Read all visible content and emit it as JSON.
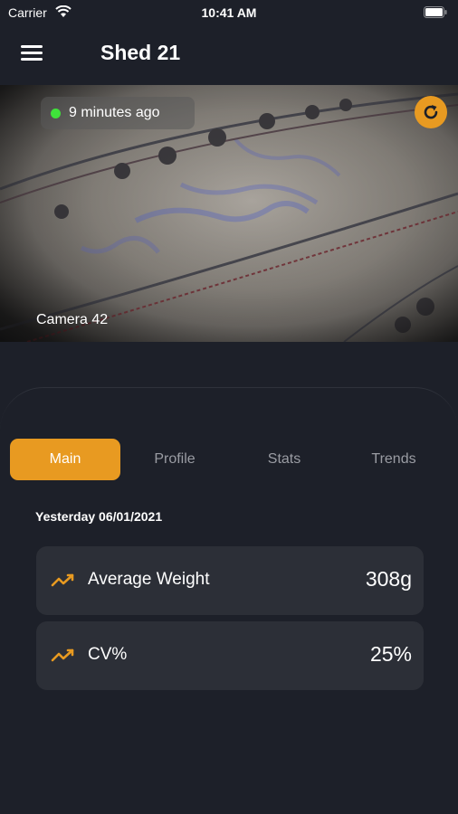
{
  "status_bar": {
    "carrier": "Carrier",
    "time": "10:41 AM"
  },
  "header": {
    "title": "Shed 21"
  },
  "camera": {
    "last_update": "9 minutes ago",
    "label": "Camera 42",
    "status_color": "#3fe33a"
  },
  "tabs": [
    {
      "label": "Main",
      "active": true
    },
    {
      "label": "Profile",
      "active": false
    },
    {
      "label": "Stats",
      "active": false
    },
    {
      "label": "Trends",
      "active": false
    }
  ],
  "summary": {
    "date": "Yesterday 06/01/2021",
    "metrics": [
      {
        "icon": "trend-line-icon",
        "label": "Average Weight",
        "value": "308g"
      },
      {
        "icon": "trend-line-icon",
        "label": "CV%",
        "value": "25%"
      }
    ]
  },
  "colors": {
    "accent": "#e89a21",
    "background": "#1d2029",
    "card": "#2c2f37"
  }
}
